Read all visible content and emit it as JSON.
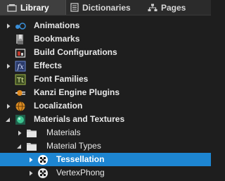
{
  "tabs": [
    {
      "label": "Library",
      "icon": "library-icon",
      "active": true
    },
    {
      "label": "Dictionaries",
      "icon": "dictionary-icon",
      "active": false
    },
    {
      "label": "Pages",
      "icon": "pages-icon",
      "active": false
    }
  ],
  "tree": [
    {
      "label": "Animations",
      "icon": "animations-icon",
      "expander": "collapsed"
    },
    {
      "label": "Bookmarks",
      "icon": "bookmarks-icon",
      "expander": "none"
    },
    {
      "label": "Build Configurations",
      "icon": "build-configurations-icon",
      "expander": "none"
    },
    {
      "label": "Effects",
      "icon": "effects-icon",
      "expander": "collapsed"
    },
    {
      "label": "Font Families",
      "icon": "font-families-icon",
      "expander": "none"
    },
    {
      "label": "Kanzi Engine Plugins",
      "icon": "plugins-icon",
      "expander": "none"
    },
    {
      "label": "Localization",
      "icon": "localization-icon",
      "expander": "collapsed"
    },
    {
      "label": "Materials and Textures",
      "icon": "materials-textures-icon",
      "expander": "expanded"
    },
    {
      "label": "Materials",
      "icon": "folder-icon",
      "expander": "collapsed"
    },
    {
      "label": "Material Types",
      "icon": "folder-icon",
      "expander": "expanded"
    },
    {
      "label": "Tessellation",
      "icon": "material-type-icon",
      "expander": "collapsed",
      "selected": true
    },
    {
      "label": "VertexPhong",
      "icon": "material-type-icon",
      "expander": "collapsed"
    }
  ],
  "colors": {
    "background": "#1e1e1e",
    "selection": "#1d85d1",
    "text": "#e8e8e8"
  }
}
